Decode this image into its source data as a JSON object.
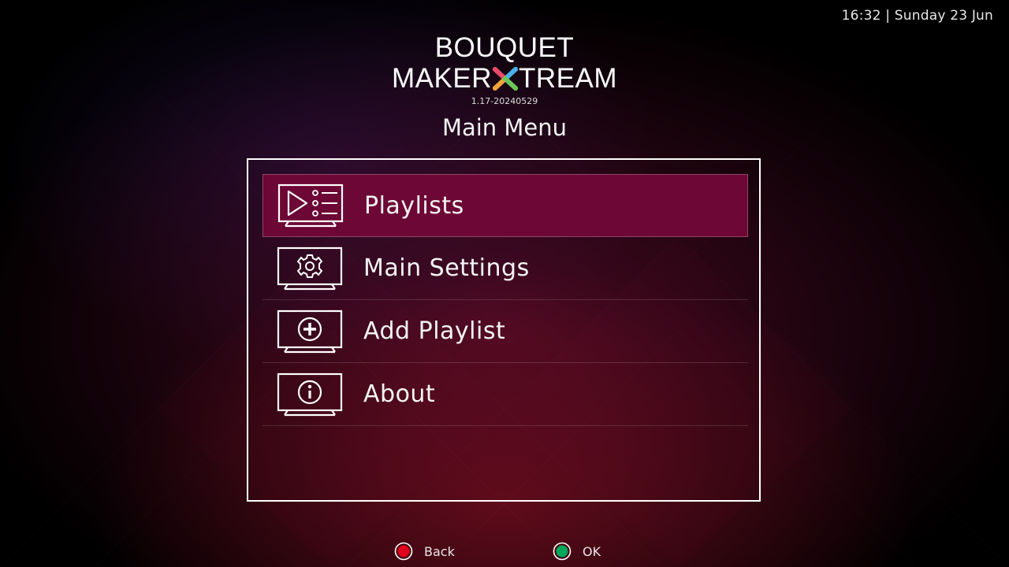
{
  "clock": {
    "text": "16:32 | Sunday 23 Jun"
  },
  "logo": {
    "line1": "BOUQUET",
    "line2_left": "MAKER",
    "line2_right": "TREAM",
    "version": "1.17-20240529"
  },
  "title": "Main Menu",
  "menu": {
    "items": [
      {
        "label": "Playlists",
        "icon": "playlist-icon",
        "selected": true
      },
      {
        "label": "Main Settings",
        "icon": "gear-icon",
        "selected": false
      },
      {
        "label": "Add Playlist",
        "icon": "add-icon",
        "selected": false
      },
      {
        "label": "About",
        "icon": "info-icon",
        "selected": false
      }
    ]
  },
  "footer": {
    "back_label": "Back",
    "ok_label": "OK"
  },
  "colors": {
    "selected_bg": "#6d0735",
    "back_button": "#e0001b",
    "ok_button": "#00a85a",
    "logo_x_colors": [
      "#e84a6a",
      "#f2a33a",
      "#4ab0e8",
      "#6cc65a"
    ]
  }
}
